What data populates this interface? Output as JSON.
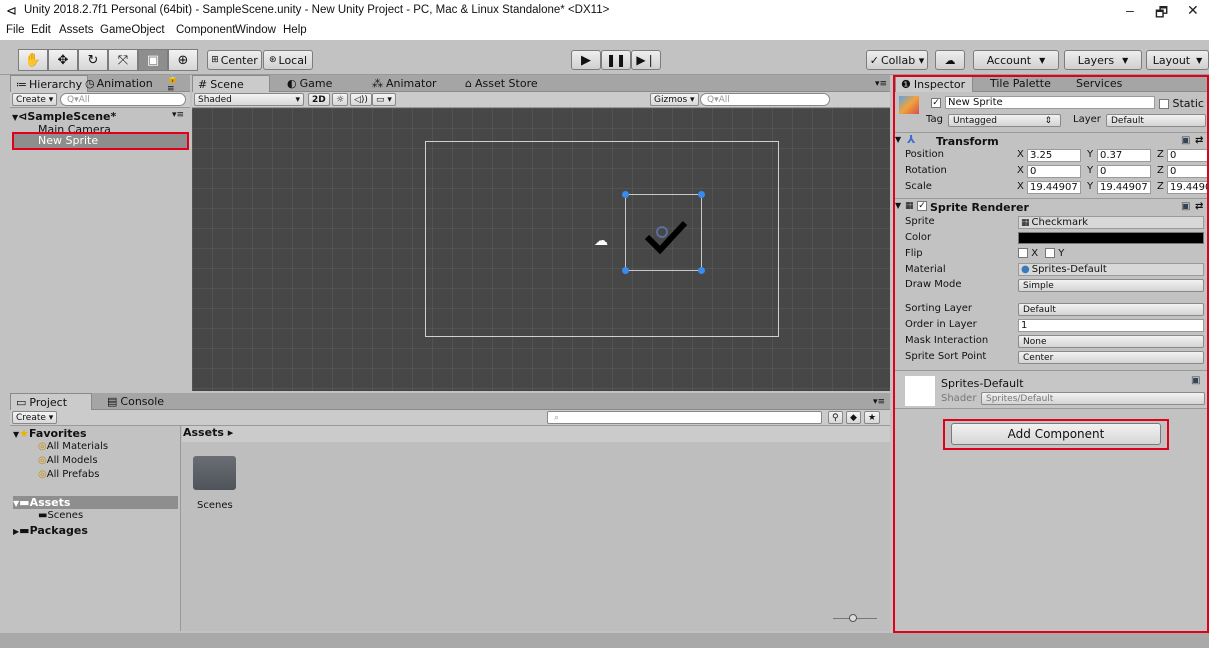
{
  "window": {
    "title": "Unity 2018.2.7f1 Personal (64bit) - SampleScene.unity - New Unity Project - PC, Mac & Linux Standalone* <DX11>",
    "minimize": "–",
    "maximize": "🗗",
    "close": "✕"
  },
  "menu": [
    "File",
    "Edit",
    "Assets",
    "GameObject",
    "Component",
    "Window",
    "Help"
  ],
  "toolbar": {
    "pivot": "Center",
    "space": "Local",
    "collab": "Collab ▾",
    "account": "Account",
    "layers": "Layers",
    "layout": "Layout"
  },
  "hierarchy": {
    "tabs": [
      "Hierarchy",
      "Animation"
    ],
    "create": "Create ▾",
    "search_placeholder": "Q▾All",
    "scene": "SampleScene*",
    "items": [
      "Main Camera",
      "New Sprite"
    ]
  },
  "scene": {
    "tabs": [
      "Scene",
      "Game",
      "Animator",
      "Asset Store"
    ],
    "shading": "Shaded",
    "mode2d": "2D",
    "gizmos": "Gizmos ▾",
    "search_placeholder": "Q▾All"
  },
  "project": {
    "tabs": [
      "Project",
      "Console"
    ],
    "create": "Create ▾",
    "favorites": "Favorites",
    "favorite_items": [
      "All Materials",
      "All Models",
      "All Prefabs"
    ],
    "assets": "Assets",
    "asset_children": [
      "Scenes"
    ],
    "packages": "Packages",
    "breadcrumb": "Assets ▸",
    "folder_label": "Scenes"
  },
  "inspector": {
    "tabs": [
      "Inspector",
      "Tile Palette",
      "Services"
    ],
    "object_name": "New Sprite",
    "static_label": "Static",
    "tag_label": "Tag",
    "tag_value": "Untagged",
    "layer_label": "Layer",
    "layer_value": "Default",
    "transform": {
      "title": "Transform",
      "position_label": "Position",
      "rotation_label": "Rotation",
      "scale_label": "Scale",
      "position": {
        "x": "3.25",
        "y": "0.37",
        "z": "0"
      },
      "rotation": {
        "x": "0",
        "y": "0",
        "z": "0"
      },
      "scale": {
        "x": "19.44907",
        "y": "19.44907",
        "z": "19.4490"
      }
    },
    "sprite_renderer": {
      "title": "Sprite Renderer",
      "sprite_label": "Sprite",
      "sprite_value": "Checkmark",
      "color_label": "Color",
      "color_value": "#000000",
      "flip_label": "Flip",
      "flip_x": "X",
      "flip_y": "Y",
      "material_label": "Material",
      "material_value": "Sprites-Default",
      "drawmode_label": "Draw Mode",
      "drawmode_value": "Simple",
      "sortinglayer_label": "Sorting Layer",
      "sortinglayer_value": "Default",
      "order_label": "Order in Layer",
      "order_value": "1",
      "mask_label": "Mask Interaction",
      "mask_value": "None",
      "sortpoint_label": "Sprite Sort Point",
      "sortpoint_value": "Center"
    },
    "material_preview": {
      "name": "Sprites-Default",
      "shader_label": "Shader",
      "shader_value": "Sprites/Default"
    },
    "add_component": "Add Component"
  },
  "colors": {
    "highlight": "#e0001a",
    "selection": "#8e8e8e"
  }
}
